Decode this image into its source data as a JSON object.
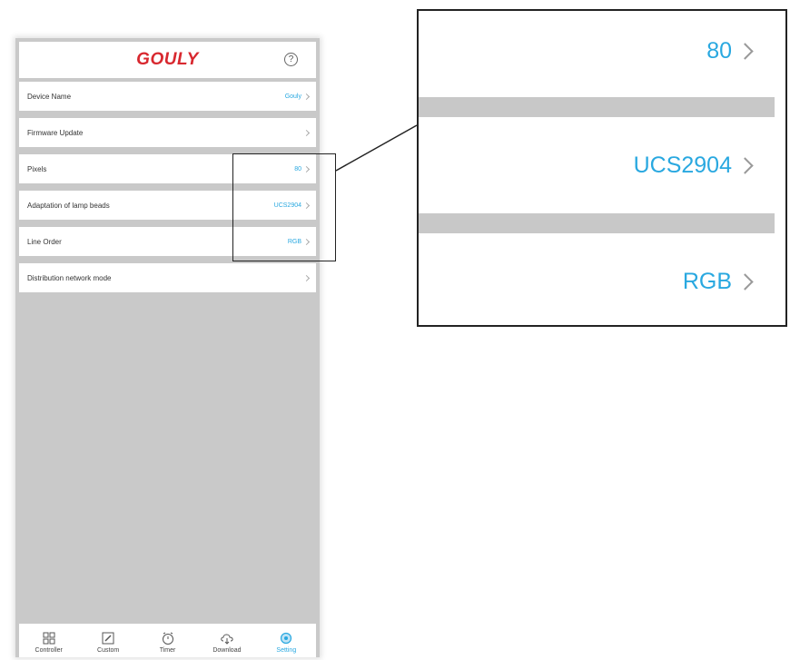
{
  "app": {
    "brand": "GOULY",
    "help_glyph": "?"
  },
  "settings": [
    {
      "label": "Device Name",
      "value": "Gouly"
    },
    {
      "label": "Firmware Update",
      "value": ""
    },
    {
      "label": "Pixels",
      "value": "80"
    },
    {
      "label": "Adaptation of lamp beads",
      "value": "UCS2904"
    },
    {
      "label": "Line Order",
      "value": "RGB"
    },
    {
      "label": "Distribution network mode",
      "value": ""
    }
  ],
  "tabs": [
    {
      "label": "Controller",
      "icon": "grid-icon",
      "active": false
    },
    {
      "label": "Custom",
      "icon": "edit-icon",
      "active": false
    },
    {
      "label": "Timer",
      "icon": "clock-icon",
      "active": false
    },
    {
      "label": "Download",
      "icon": "cloud-download-icon",
      "active": false
    },
    {
      "label": "Setting",
      "icon": "gear-icon",
      "active": true
    }
  ],
  "zoom": {
    "values": [
      "80",
      "UCS2904",
      "RGB"
    ]
  },
  "colors": {
    "brand": "#d8282f",
    "accent": "#29a8e0",
    "background": "#c9c9c9"
  }
}
